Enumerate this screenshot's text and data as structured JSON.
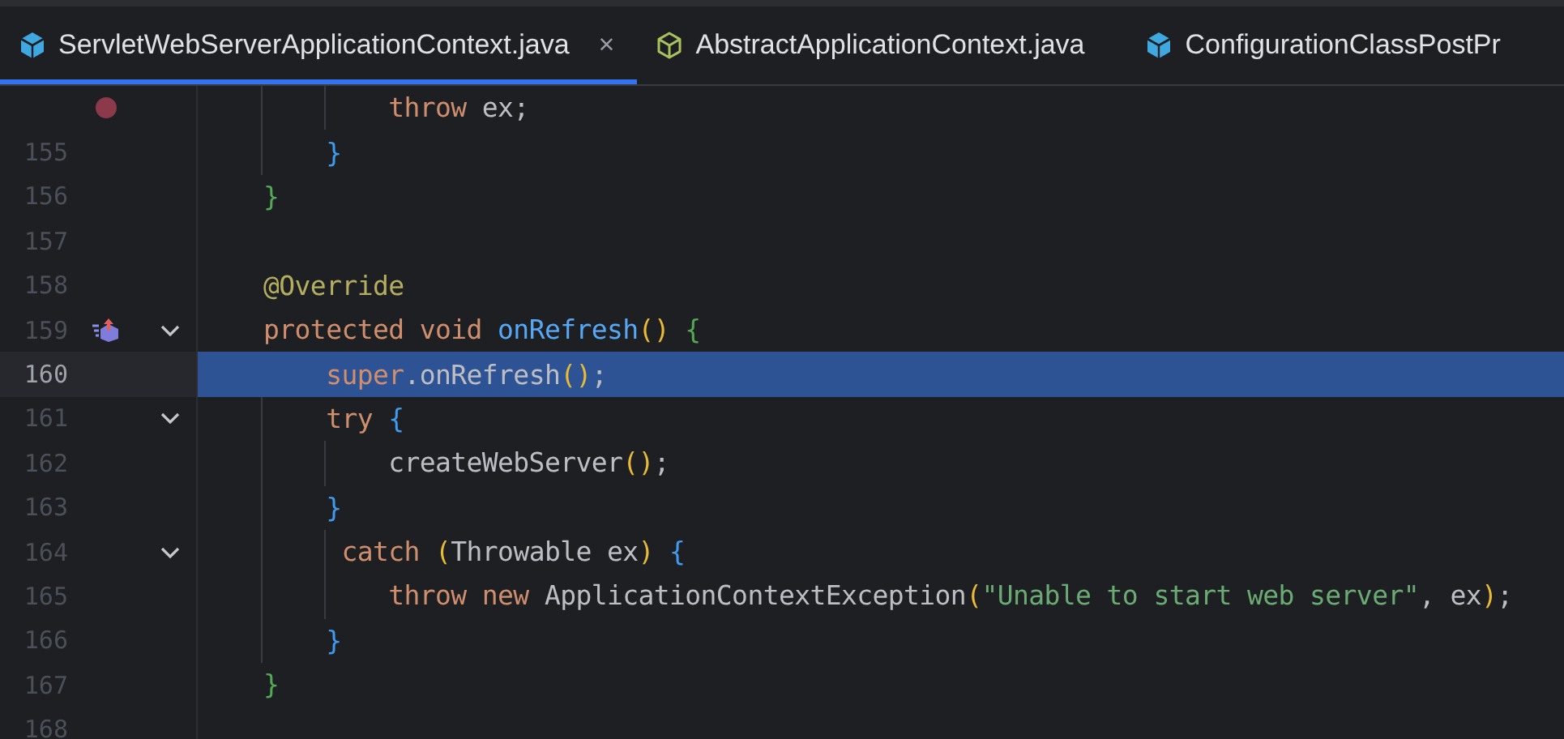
{
  "tabs": [
    {
      "label": "ServletWebServerApplicationContext.java",
      "kind": "class",
      "selected": true,
      "close": "×"
    },
    {
      "label": "AbstractApplicationContext.java",
      "kind": "abstract-class",
      "selected": false
    },
    {
      "label": "ConfigurationClassPostPr",
      "kind": "class",
      "selected": false
    }
  ],
  "lines": [
    {
      "breakpoint": true,
      "fold": false,
      "overridden": false,
      "current": false,
      "tokens": [
        {
          "kind": "keyword",
          "text": "            throw "
        },
        {
          "kind": "plain",
          "text": "ex;"
        }
      ]
    },
    {
      "number": "155",
      "breakpoint": false,
      "fold": false,
      "overridden": false,
      "current": false,
      "tokens": [
        {
          "kind": "brace-blue",
          "text": "        }"
        }
      ]
    },
    {
      "number": "156",
      "breakpoint": false,
      "fold": false,
      "overridden": false,
      "current": false,
      "tokens": [
        {
          "kind": "brace-green",
          "text": "    }"
        }
      ]
    },
    {
      "number": "157",
      "breakpoint": false,
      "fold": false,
      "overridden": false,
      "current": false
    },
    {
      "number": "158",
      "breakpoint": false,
      "fold": false,
      "overridden": false,
      "current": false,
      "tokens": [
        {
          "kind": "annotation",
          "text": "    @Override"
        }
      ]
    },
    {
      "number": "159",
      "breakpoint": false,
      "fold": true,
      "overridden": true,
      "current": false,
      "tokens": [
        {
          "kind": "keyword",
          "text": "    protected void "
        },
        {
          "kind": "method",
          "text": "onRefresh"
        },
        {
          "kind": "paren",
          "text": "() "
        },
        {
          "kind": "brace-green",
          "text": "{"
        }
      ]
    },
    {
      "number": "160",
      "breakpoint": false,
      "fold": false,
      "overridden": false,
      "current": true,
      "tokens": [
        {
          "kind": "keyword",
          "text": "        super"
        },
        {
          "kind": "plain",
          "text": ".onRefresh"
        },
        {
          "kind": "paren",
          "text": "()"
        },
        {
          "kind": "plain",
          "text": ";"
        }
      ]
    },
    {
      "number": "161",
      "breakpoint": false,
      "fold": true,
      "overridden": false,
      "current": false,
      "tokens": [
        {
          "kind": "keyword",
          "text": "        try "
        },
        {
          "kind": "brace-blue",
          "text": "{"
        }
      ]
    },
    {
      "number": "162",
      "breakpoint": false,
      "fold": false,
      "overridden": false,
      "current": false,
      "tokens": [
        {
          "kind": "plain",
          "text": "            createWebServer"
        },
        {
          "kind": "paren",
          "text": "()"
        },
        {
          "kind": "plain",
          "text": ";"
        }
      ]
    },
    {
      "number": "163",
      "breakpoint": false,
      "fold": false,
      "overridden": false,
      "current": false,
      "tokens": [
        {
          "kind": "brace-blue",
          "text": "        }"
        }
      ]
    },
    {
      "number": "164",
      "breakpoint": false,
      "fold": true,
      "overridden": false,
      "current": false,
      "tokens": [
        {
          "kind": "keyword",
          "text": "         catch "
        },
        {
          "kind": "paren",
          "text": "("
        },
        {
          "kind": "plain",
          "text": "Throwable ex"
        },
        {
          "kind": "paren",
          "text": ") "
        },
        {
          "kind": "brace-blue",
          "text": "{"
        }
      ]
    },
    {
      "number": "165",
      "breakpoint": false,
      "fold": false,
      "overridden": false,
      "current": false,
      "tokens": [
        {
          "kind": "keyword",
          "text": "            throw new "
        },
        {
          "kind": "plain",
          "text": "ApplicationContextException"
        },
        {
          "kind": "paren",
          "text": "("
        },
        {
          "kind": "string",
          "text": "\"Unable to start web server\""
        },
        {
          "kind": "plain",
          "text": ", ex"
        },
        {
          "kind": "paren",
          "text": ")"
        },
        {
          "kind": "plain",
          "text": ";"
        }
      ]
    },
    {
      "number": "166",
      "breakpoint": false,
      "fold": false,
      "overridden": false,
      "current": false,
      "tokens": [
        {
          "kind": "brace-blue",
          "text": "        }"
        }
      ]
    },
    {
      "number": "167",
      "breakpoint": false,
      "fold": false,
      "overridden": false,
      "current": false,
      "tokens": [
        {
          "kind": "brace-green",
          "text": "    }"
        }
      ]
    },
    {
      "number": "168",
      "breakpoint": false,
      "fold": false,
      "overridden": false,
      "current": false
    }
  ]
}
